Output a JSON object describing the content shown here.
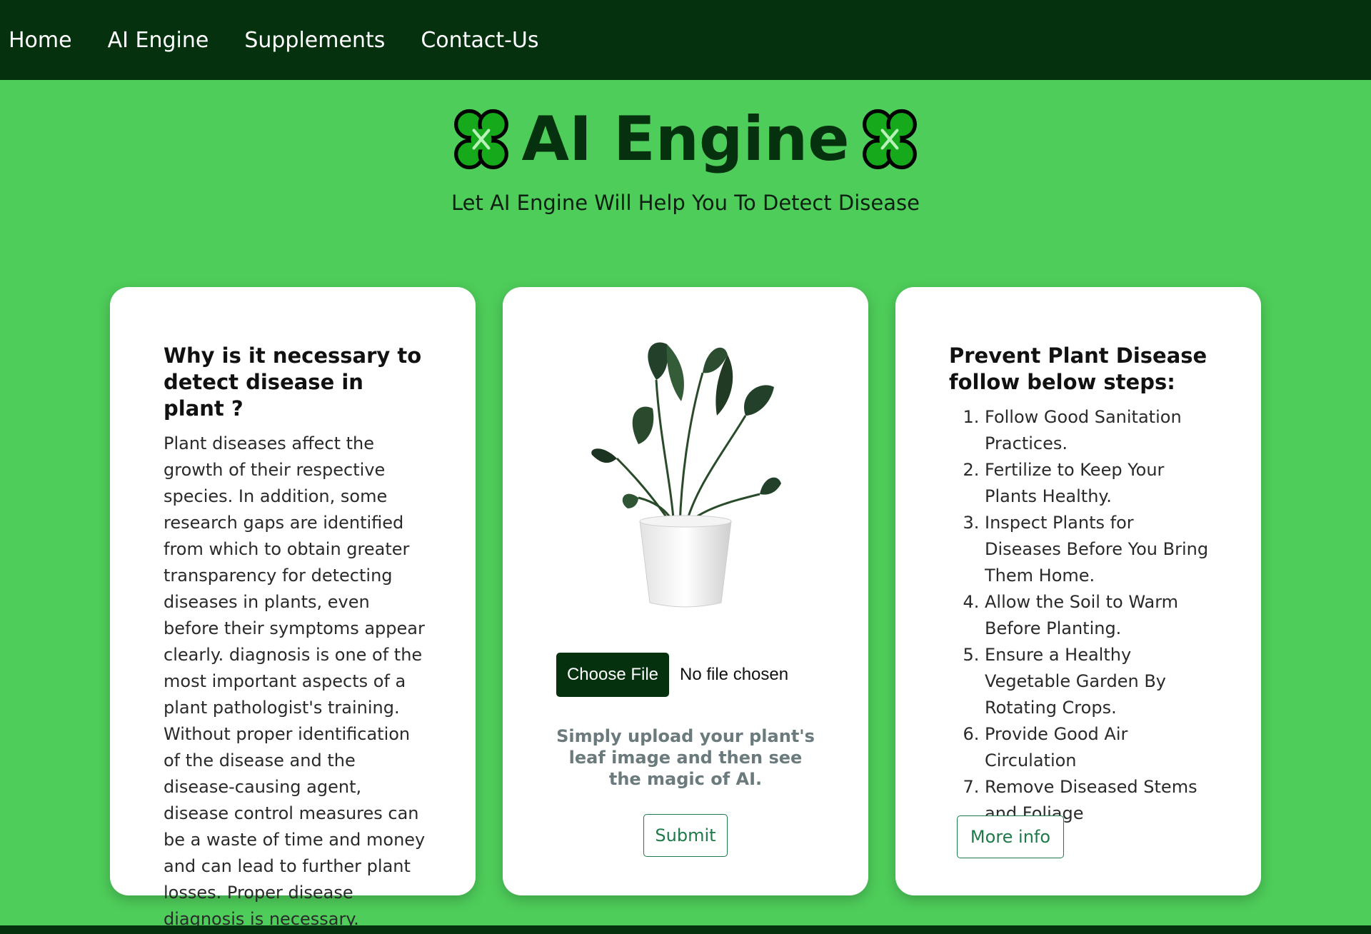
{
  "colors": {
    "nav_bg": "#05310f",
    "page_bg": "#4ecd5a",
    "accent": "#1f7a4a"
  },
  "nav": {
    "items": [
      {
        "label": "Home"
      },
      {
        "label": "AI Engine"
      },
      {
        "label": "Supplements"
      },
      {
        "label": "Contact-Us"
      }
    ]
  },
  "hero": {
    "title": "AI Engine",
    "subtitle": "Let AI Engine Will Help You To Detect Disease",
    "icon": "four-leaf-clover-icon"
  },
  "left_card": {
    "title": "Why is it necessary to detect disease in plant ?",
    "body": "Plant diseases affect the growth of their respective species. In addition, some research gaps are identified from which to obtain greater transparency for detecting diseases in plants, even before their symptoms appear clearly. diagnosis is one of the most important aspects of a plant pathologist's training. Without proper identification of the disease and the disease-causing agent, disease control measures can be a waste of time and money and can lead to further plant losses. Proper disease diagnosis is necessary."
  },
  "middle_card": {
    "image": "potted-plant-image",
    "choose_file_label": "Choose File",
    "file_status": "No file chosen",
    "hint": "Simply upload your plant's leaf image and then see the magic of AI.",
    "submit_label": "Submit"
  },
  "right_card": {
    "title": "Prevent Plant Disease follow below steps:",
    "steps": [
      "Follow Good Sanitation Practices.",
      "Fertilize to Keep Your Plants Healthy.",
      "Inspect Plants for Diseases Before You Bring Them Home.",
      "Allow the Soil to Warm Before Planting.",
      "Ensure a Healthy Vegetable Garden By Rotating Crops.",
      "Provide Good Air Circulation",
      "Remove Diseased Stems and Foliage"
    ],
    "more_label": "More info"
  }
}
